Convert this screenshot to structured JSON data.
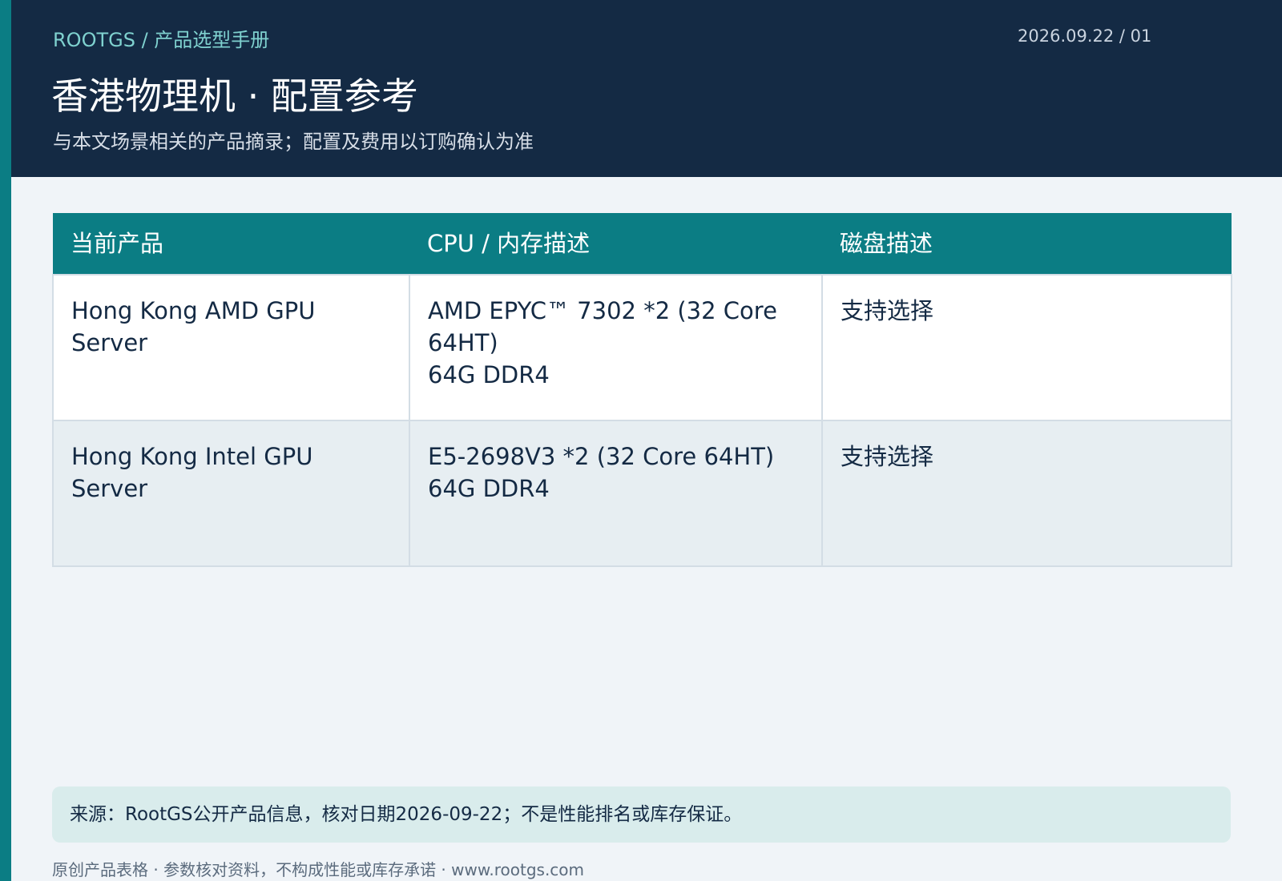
{
  "header": {
    "breadcrumb": "ROOTGS / 产品选型手册",
    "date": "2026.09.22 / 01",
    "title": "香港物理机 · 配置参考",
    "subtitle": "与本文场景相关的产品摘录；配置及费用以订购确认为准"
  },
  "table": {
    "columns": [
      "当前产品",
      "CPU / 内存描述",
      "磁盘描述"
    ],
    "rows": [
      {
        "product": "Hong Kong AMD GPU Server",
        "cpu_memory": "AMD EPYC™ 7302 *2 (32 Core 64HT)\n64G DDR4",
        "disk": "支持选择"
      },
      {
        "product": "Hong Kong Intel GPU Server",
        "cpu_memory": "E5-2698V3 *2 (32 Core 64HT)\n64G DDR4",
        "disk": "支持选择"
      }
    ]
  },
  "source_note": "来源：RootGS公开产品信息，核对日期2026-09-22；不是性能排名或库存保证。",
  "footer": "原创产品表格 · 参数核对资料，不构成性能或库存承诺 · www.rootgs.com",
  "colors": {
    "header_bg": "#142a44",
    "accent": "#0b7d84",
    "breadcrumb": "#7fd1cf",
    "page_bg": "#f0f4f8",
    "note_bg": "#d9ecec"
  }
}
